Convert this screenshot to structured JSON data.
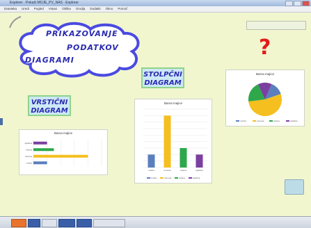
{
  "window": {
    "title": "Explorer · Pokaži MOJE_PV_NAS · Explorer",
    "menu": [
      "Datoteka",
      "Uredi",
      "Pogled",
      "Vstavi",
      "Oblika",
      "Orodja",
      "Dodatki",
      "Okno",
      "Pomoč"
    ]
  },
  "page": {
    "cloud_title": [
      "PRIKAZOVANJE",
      "PODATKOV",
      "DIAGRAMI"
    ],
    "label_stolpcni": [
      "STOLPČNI",
      "DIAGRAM"
    ],
    "label_vrsticni": [
      "VRSTIČNI",
      "DIAGRAM"
    ],
    "question_mark": "?"
  },
  "colors": {
    "blue": "#5b7fbe",
    "yellow": "#f5bf1f",
    "green": "#2ea84a",
    "purple": "#7b3fa0",
    "red": "#e41a1a"
  },
  "chart_data": [
    {
      "type": "bar",
      "title": "Barva majice",
      "categories": [
        "modra",
        "rumena",
        "zelena",
        "vijolična"
      ],
      "values": [
        2,
        8,
        3,
        2
      ],
      "ylim": [
        0,
        9
      ]
    },
    {
      "type": "bar",
      "orientation": "horizontal",
      "title": "Barva majice",
      "categories": [
        "modra",
        "rumena",
        "zelena",
        "vijolična"
      ],
      "values": [
        2,
        8,
        3,
        2
      ],
      "xlim": [
        0,
        10
      ]
    },
    {
      "type": "pie",
      "title": "Barva majice",
      "categories": [
        "modra",
        "rumena",
        "zelena",
        "vijolična"
      ],
      "values": [
        2,
        8,
        3,
        2
      ]
    }
  ]
}
